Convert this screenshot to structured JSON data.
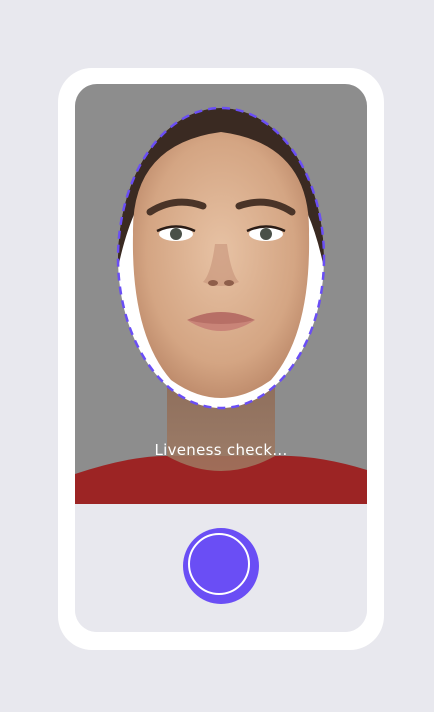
{
  "liveness": {
    "status_text": "Liveness check..."
  },
  "capture": {
    "icon": "capture-circle-icon"
  },
  "colors": {
    "accent": "#6a4ef5",
    "frame": "#ffffff",
    "background": "#e8e8ee",
    "camera_background": "#8d8d8d",
    "shirt": "#9c2424"
  }
}
